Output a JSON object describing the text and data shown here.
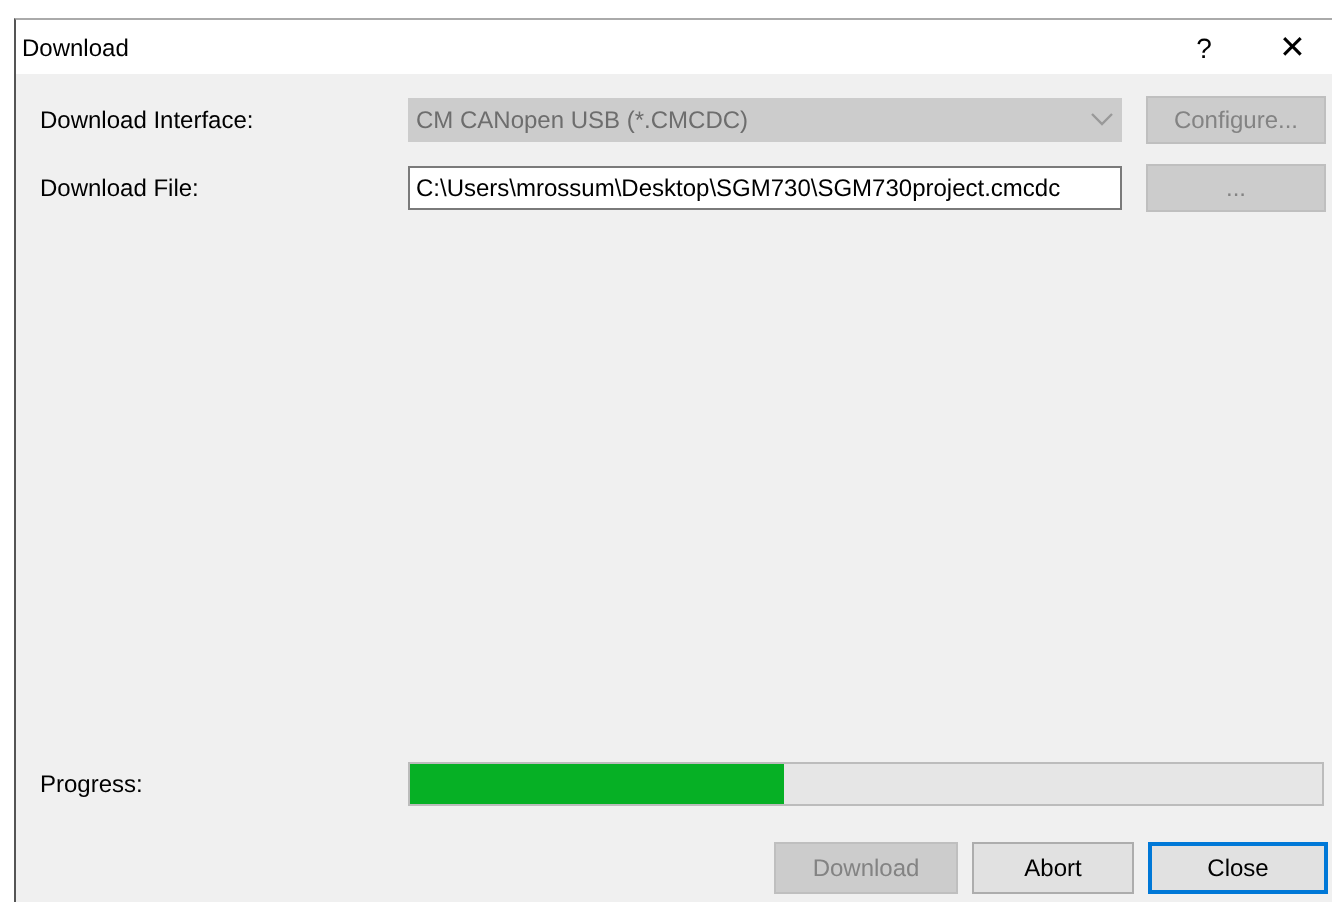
{
  "window": {
    "title": "Download",
    "help": "?",
    "close": "✕"
  },
  "interface": {
    "label": "Download Interface:",
    "value": "CM CANopen USB (*.CMCDC)",
    "disabled": true,
    "button": {
      "label": "Configure...",
      "disabled": true
    }
  },
  "file": {
    "label": "Download File:",
    "value": "C:\\Users\\mrossum\\Desktop\\SGM730\\SGM730project.cmcdc",
    "button": {
      "label": "...",
      "disabled": true
    }
  },
  "progress": {
    "label": "Progress:",
    "level": 0.41
  },
  "buttons": [
    {
      "label": "Download",
      "disabled": true,
      "focused": false
    },
    {
      "label": "Abort",
      "disabled": false,
      "focused": false
    },
    {
      "label": "Close",
      "disabled": false,
      "focused": true
    }
  ]
}
